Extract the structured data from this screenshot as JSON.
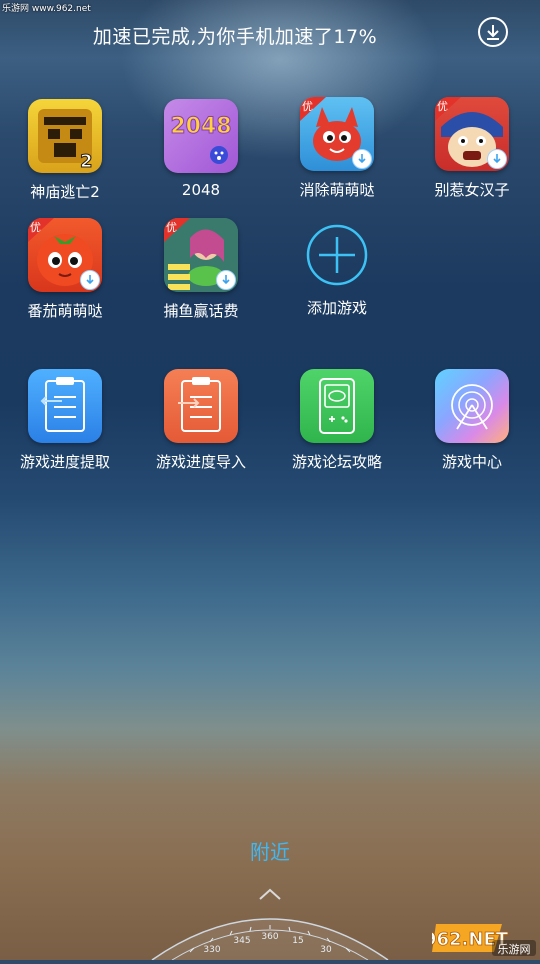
{
  "watermark_top": "乐游网 www.962.net",
  "header": {
    "text": "加速已完成,为你手机加速了17%",
    "download_icon": "download-circle-icon"
  },
  "games": [
    {
      "label": "神庙逃亡2",
      "icon": "temple-run-2-icon"
    },
    {
      "label": "2048",
      "icon": "2048-icon",
      "icon_text": "2048"
    },
    {
      "label": "消除萌萌哒",
      "icon": "cute-eliminate-icon",
      "badge": "优"
    },
    {
      "label": "别惹女汉子",
      "icon": "tough-girl-icon",
      "badge": "优"
    },
    {
      "label": "番茄萌萌哒",
      "icon": "tomato-icon",
      "badge": "优"
    },
    {
      "label": "捕鱼赢话费",
      "icon": "fishing-icon",
      "badge": "优"
    },
    {
      "label": "添加游戏",
      "icon": "add-circle-icon"
    }
  ],
  "tools": [
    {
      "label": "游戏进度提取",
      "icon": "progress-extract-icon",
      "color": "#2f8ff0"
    },
    {
      "label": "游戏进度导入",
      "icon": "progress-import-icon",
      "color": "#ee6a45"
    },
    {
      "label": "游戏论坛攻略",
      "icon": "forum-guide-icon",
      "color": "#3cc55a"
    },
    {
      "label": "游戏中心",
      "icon": "game-center-icon",
      "color": "#7aa9ff"
    }
  ],
  "nearby": {
    "label": "附近"
  },
  "compass": {
    "ticks": [
      "330",
      "345",
      "360",
      "15",
      "30"
    ]
  },
  "logo_watermark": {
    "text": "962.NET",
    "subtext": "乐游网"
  }
}
